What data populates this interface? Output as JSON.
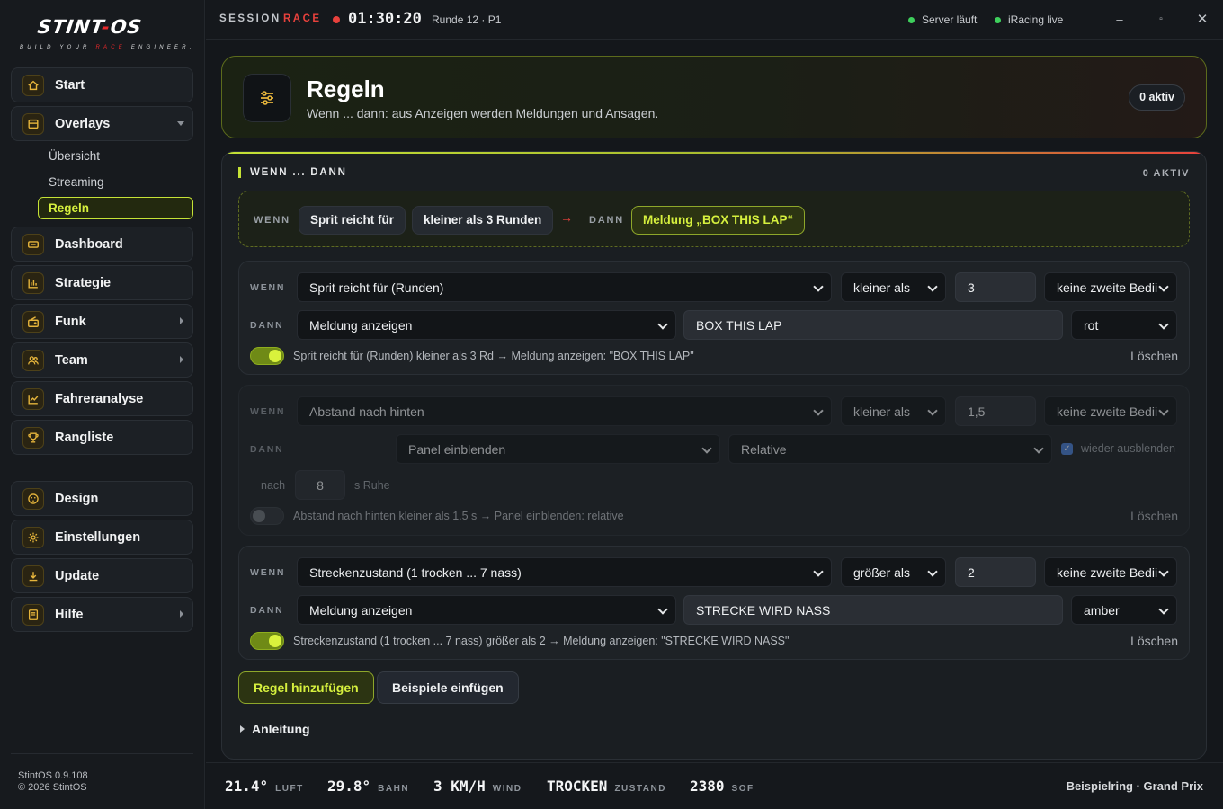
{
  "app": {
    "logo_text_a": "STINT",
    "logo_text_b": "OS",
    "tagline_a": "BUILD YOUR",
    "tagline_b": "RACE",
    "tagline_c": "ENGINEER.",
    "version": "StintOS 0.9.108",
    "copyright": "© 2026 StintOS"
  },
  "sidebar": {
    "items": [
      {
        "label": "Start",
        "icon": "home-icon"
      },
      {
        "label": "Overlays",
        "icon": "overlay-icon",
        "expanded": true
      },
      {
        "label": "Dashboard",
        "icon": "dashboard-icon"
      },
      {
        "label": "Strategie",
        "icon": "bar-chart-icon"
      },
      {
        "label": "Funk",
        "icon": "radio-icon"
      },
      {
        "label": "Team",
        "icon": "team-icon"
      },
      {
        "label": "Fahreranalyse",
        "icon": "line-chart-icon"
      },
      {
        "label": "Rangliste",
        "icon": "trophy-icon"
      },
      {
        "label": "Design",
        "icon": "palette-icon"
      },
      {
        "label": "Einstellungen",
        "icon": "gear-icon"
      },
      {
        "label": "Update",
        "icon": "download-icon"
      },
      {
        "label": "Hilfe",
        "icon": "book-icon"
      }
    ],
    "subitems": [
      "Übersicht",
      "Streaming",
      "Regeln"
    ]
  },
  "topbar": {
    "session_label": "SESSION",
    "session_type": "RACE",
    "timer": "01:30:20",
    "lap": "Runde 12 · P1",
    "status_server": "Server läuft",
    "status_iracing": "iRacing live",
    "status_color": "#3ecf5c"
  },
  "hero": {
    "title": "Regeln",
    "subtitle": "Wenn ... dann: aus Anzeigen werden Meldungen und Ansagen.",
    "badge": "0 aktiv"
  },
  "panel": {
    "heading": "WENN ... DANN",
    "count": "0 AKTIV",
    "example": {
      "wenn_label": "WENN",
      "cond": "Sprit reicht für",
      "op": "kleiner als 3 Runden",
      "arrow": "→",
      "dann_label": "DANN",
      "action": "Meldung „BOX THIS LAP“"
    },
    "rules": [
      {
        "enabled": true,
        "wenn_label": "WENN",
        "dann_label": "DANN",
        "condition": "Sprit reicht für (Runden)",
        "operator": "kleiner als",
        "value": "3",
        "second": "keine zweite Bedii",
        "action": "Meldung anzeigen",
        "message": "BOX THIS LAP",
        "color": "rot",
        "summary": "Sprit reicht für (Runden) kleiner als 3 Rd → Meldung anzeigen: \"BOX THIS LAP\"",
        "delete": "Löschen"
      },
      {
        "enabled": false,
        "wenn_label": "WENN",
        "dann_label": "DANN",
        "condition": "Abstand nach hinten",
        "operator": "kleiner als",
        "value": "1,5",
        "second": "keine zweite Bedii",
        "action": "Panel einblenden",
        "panel": "Relative",
        "rehide_checked": true,
        "rehide_label": "wieder ausblenden",
        "after_label": "nach",
        "after_value": "8",
        "after_unit": "s Ruhe",
        "summary": "Abstand nach hinten kleiner als 1.5 s → Panel einblenden: relative",
        "delete": "Löschen"
      },
      {
        "enabled": true,
        "wenn_label": "WENN",
        "dann_label": "DANN",
        "condition": "Streckenzustand (1 trocken ... 7 nass)",
        "operator": "größer als",
        "value": "2",
        "second": "keine zweite Bedii",
        "action": "Meldung anzeigen",
        "message": "STRECKE WIRD NASS",
        "color": "amber",
        "summary": "Streckenzustand (1 trocken ... 7 nass) größer als 2 → Meldung anzeigen: \"STRECKE WIRD NASS\"",
        "delete": "Löschen"
      }
    ],
    "add_rule": "Regel hinzufügen",
    "insert_examples": "Beispiele einfügen",
    "guide": "Anleitung"
  },
  "weather": [
    {
      "value": "21.4°",
      "label": "LUFT"
    },
    {
      "value": "29.8°",
      "label": "BAHN"
    },
    {
      "value": "3 KM/H",
      "label": "WIND"
    },
    {
      "value": "TROCKEN",
      "label": "ZUSTAND"
    },
    {
      "value": "2380",
      "label": "SOF"
    }
  ],
  "track": "Beispielring · Grand Prix",
  "colors": {
    "accent": "#c5e236",
    "danger": "#e8413c",
    "icon_gold": "#e6b53c"
  }
}
